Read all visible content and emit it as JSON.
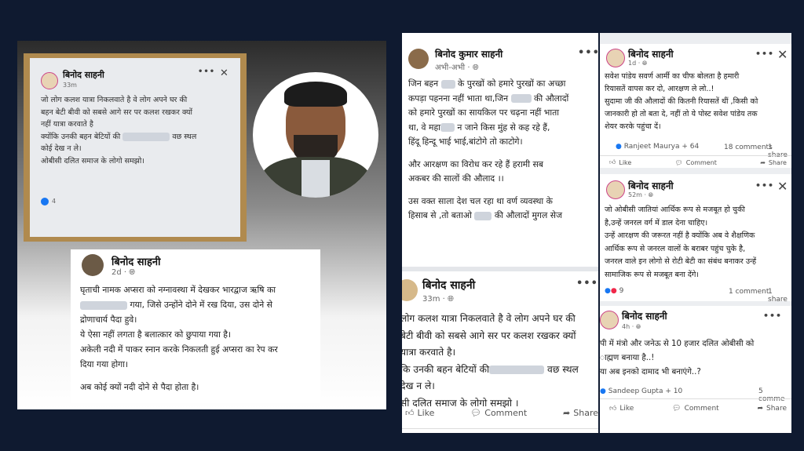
{
  "left_panel": {
    "photo_post": {
      "author": "बिनोद साहनी",
      "time": "33m",
      "lines": [
        "जो लोग कलश यात्रा निकलवाते है वे लोग अपने घर की",
        "बहन बेटी बीवी को सबसे आगे सर पर कलश रखकर क्यों",
        "नहीं यात्रा करवाते है",
        "क्योंकि उनकी बहन बेटियों की",
        "वछ स्थल",
        "कोई देख न ले।",
        "ओबीसी दलित समाज के लोगो समझो।"
      ],
      "reactions": "4"
    },
    "post2": {
      "author": "बिनोद साहनी",
      "time": "2d",
      "lines": [
        "घृताची नामक अप्सरा को नग्नावस्था में देखकर भारद्वाज ऋषि का",
        "गया, जिसे उन्होंने दोने में रख दिया, उस दोने से",
        "द्रोणाचार्य पैदा हुवे।",
        "ये ऐसा नहीं लगता है बलात्कार को छुपाया गया है।",
        "अकेली नदी में पाकर स्नान करके निकलती हुई अप्सरा का रेप कर",
        "दिया गया होगा।",
        "",
        "अब कोई क्यों नदी दोने से पैदा होता है।"
      ]
    }
  },
  "middle_panel": {
    "post1": {
      "author": "बिनोद कुमार साहनी",
      "time": "अभी-अभी",
      "lines": [
        "जिन बहन",
        "के पुरखों को हमारे पुरखों का अच्छा",
        "कपड़ा पहनना नहीं भाता था,जिन",
        "की औलादों",
        "को हमारे पुरखों का सायकिल पर चढ़ना नहीं भाता",
        "था, वे महा",
        "न जाने किस मुंह से कह रहे हैं,",
        "हिंदू हिन्दू भाई भाई,बांटोगे तो काटोगे।",
        "और आरक्षण का विरोध कर रहे हैं हरामी सब",
        "अकबर की सालों की औलाद ।।",
        "उस वक्त साला देश चल रहा था वर्ण व्यवस्था के",
        "हिसाब से ,तो बताओ",
        "की औलादों मुगल सेज"
      ]
    },
    "post2": {
      "author": "बिनोद साहनी",
      "time": "33m",
      "lines": [
        "लोग कलश यात्रा निकलवाते है वे लोग अपने घर की",
        "बेटी बीवी को सबसे आगे सर पर कलश रखकर क्यों",
        "यात्रा करवाते है।",
        "कि उनकी बहन बेटियों की",
        "वछ स्थल",
        "देख न ले।",
        "सी दलित समाज के लोगो समझो ।"
      ],
      "like": "Like",
      "comment": "Comment",
      "share": "Share"
    }
  },
  "right_panel": {
    "post1": {
      "author": "बिनोद साहनी",
      "time": "1d",
      "lines": [
        "सवेश पांडेय सवर्ण आर्मी का चीफ बोलता है हमारी",
        "रियासतें वापस कर दो, आरक्षण ले लो..!",
        "सुदामा जी की औलादों की कितनी रियासतें थीं ,किसी को",
        "जानकारी हो तो बता दे, नहीं तो ये पोस्ट सवेश पांडेय तक",
        "शेयर करके पहुंचा दें।"
      ],
      "reactors": "Ranjeet Maurya + 64",
      "comments": "18 comments",
      "shares": "1 share",
      "like": "Like",
      "comment": "Comment",
      "share": "Share"
    },
    "post2": {
      "author": "बिनोद साहनी",
      "time": "52m",
      "lines": [
        "जो ओबीसी जातियां आर्थिक रूप से मजबूत हो चुकी",
        "है,उन्हें जनरल वर्ग में डाल देना चाहिए।",
        "उन्हें आरक्षण की जरूरत नहीं है क्योंकि अब वे शैक्षणिक",
        "आर्थिक रूप से जनरल वालों के बराबर पहुंच चुके है,",
        "जनरल वाले इन लोगो से रोटी बेटी का संबंध बनाकर उन्हें",
        "सामाजिक रूप से मजबूत बना देंगे।"
      ],
      "reactions": "9",
      "comments": "1 comment",
      "shares": "1 share"
    },
    "post3": {
      "author": "बिनोद साहनी",
      "time": "4h",
      "lines": [
        "पी में मंत्रो और जनेऊ से 10 हजार दलित ओबीसी को",
        "ाह्मण बनाया है..!",
        "या अब इनको दामाद भी बनाएंगे..?"
      ],
      "reactors": "Sandeep Gupta + 10",
      "comments": "5 comme",
      "like": "Like",
      "comment": "Comment",
      "share": "Share"
    }
  }
}
